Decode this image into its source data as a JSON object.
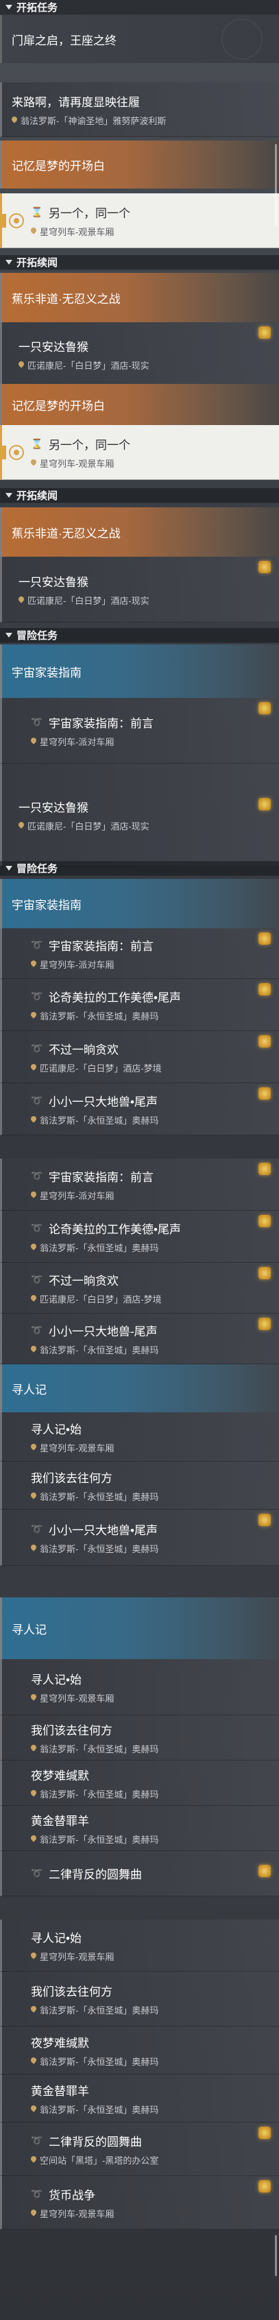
{
  "sections": {
    "trailblaze_mission": "开拓任务",
    "trailblaze_continuance": "开拓续闻",
    "adventure_mission": "冒险任务"
  },
  "chapters": {
    "door_king": "门扉之启，王座之终",
    "memory_prologue": "记忆是梦的开场白",
    "bananas": "蕉乐非道·无忍义之战",
    "home_guide": "宇宙家装指南",
    "search_person": "寻人记"
  },
  "quests": {
    "from_road": "来路啊，请再度显映往履",
    "another_same": "另一个，同一个",
    "one_monkey": "一只安达鲁猴",
    "home_guide_intro": "宇宙家装指南：前言",
    "nocey_epilogue": "论奇美拉的工作美德•尾声",
    "nocey_epilogue_b": "论奇美拉的工作美德•尾声",
    "moment_greedy": "不过一晌贪欢",
    "small_creature_epilogue": "小小一只大地兽•尾声",
    "small_creature_epilogue_b": "小小一只大地兽-尾声",
    "search_start": "寻人记•始",
    "where_go": "我们该去往何方",
    "dream_silent": "夜梦难缄默",
    "golden_scapegoat": "黄金替罪羊",
    "duet_ballad": "二律背反的圆舞曲",
    "currency_war": "货币战争"
  },
  "locations": {
    "okhema_sacred": "翁法罗斯-「神谕圣地」雅努萨波利斯",
    "express_parlor": "星穹列车-观景车厢",
    "penacony_dreamscape": "匹诺康尼-「白日梦」酒店-现实",
    "penacony_dream": "匹诺康尼-「白日梦」酒店-梦境",
    "express_party": "星穹列车-派对车厢",
    "okhema_city": "翁法罗斯-「永恒圣城」奥赫玛",
    "space_station": "空间站「黑塔」-黑塔的办公室"
  },
  "colors": {
    "accent_gold": "#d9a445",
    "orange_banner": "#b76c34",
    "blue_banner": "#2f6e92",
    "selected_bg": "#efefec"
  },
  "icons": {
    "section": "triangle-down-icon",
    "location": "location-pin-icon",
    "hourglass": "hourglass-icon",
    "quest": "quest-swirl-icon",
    "reward": "reward-chest-icon",
    "tracking": "tracking-target-icon"
  }
}
